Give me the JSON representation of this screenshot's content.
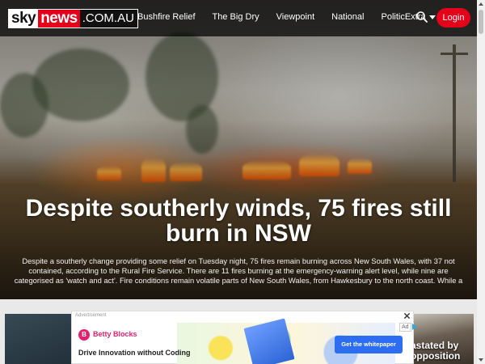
{
  "brand": {
    "logo_sky": "sky",
    "logo_news": "news",
    "logo_domain": ".COM.AU",
    "accent": "#e4001b"
  },
  "nav": {
    "items": [
      {
        "label": "Bushfire Relief"
      },
      {
        "label": "The Big Dry"
      },
      {
        "label": "Viewpoint"
      },
      {
        "label": "National"
      },
      {
        "label": "PoliticExtra"
      }
    ],
    "search_icon": "search-icon",
    "login_label": "Login"
  },
  "hero": {
    "headline": "Despite southerly winds, 75 fires still burn in NSW",
    "summary": "Despite a southerly change providing some relief on Tuesday night, 75 fires remain burning across New South Wales, with 37 not contained, according to the Rural Fire Service. There are 11 fires burning at the emergency-warning alert level, while nine are categorised as 'watch and act'. Fire conditions remain volatile parts of New South Wales, from Hawkesbury to the north coast. While a southerly moving up the coast is expecte..."
  },
  "ad": {
    "label": "Advertisement",
    "badge": "Ad",
    "brand_initial": "B",
    "brand": "Betty Blocks",
    "tagline": "Drive Innovation without Coding",
    "cta": "Get the whitepaper"
  },
  "cards": {
    "right_text_line1": "astated by",
    "right_text_line2": "opposition"
  }
}
